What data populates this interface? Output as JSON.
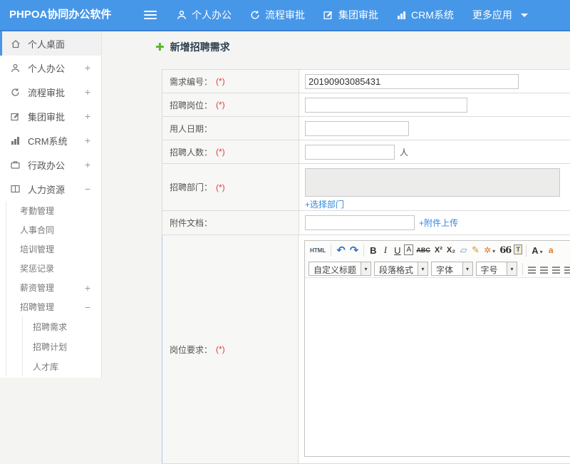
{
  "colors": {
    "header_bg": "#4797e8",
    "header_border": "#3b7fd4",
    "active_item_accent": "#4797e8",
    "link_blue": "#3388dd",
    "required_red": "#e43c3c",
    "title_text": "#2f4050",
    "add_icon_green": "#55b82a"
  },
  "header": {
    "logo": "PHPOA协同办公软件",
    "nav_items": [
      {
        "label": "个人办公",
        "icon": "person-icon"
      },
      {
        "label": "流程审批",
        "icon": "workflow-icon"
      },
      {
        "label": "集团审批",
        "icon": "edit-icon"
      },
      {
        "label": "CRM系统",
        "icon": "bar-chart-icon"
      },
      {
        "label": "更多应用",
        "icon": "caret-down-icon"
      }
    ]
  },
  "sidebar": {
    "items": [
      {
        "label": "个人桌面",
        "icon": "home-icon",
        "active": true,
        "expand": ""
      },
      {
        "label": "个人办公",
        "icon": "person-icon",
        "expand": "+"
      },
      {
        "label": "流程审批",
        "icon": "workflow-icon",
        "expand": "+"
      },
      {
        "label": "集团审批",
        "icon": "edit-icon",
        "expand": "+"
      },
      {
        "label": "CRM系统",
        "icon": "bar-chart-icon",
        "expand": "+"
      },
      {
        "label": "行政办公",
        "icon": "briefcase-icon",
        "expand": "+"
      },
      {
        "label": "人力资源",
        "icon": "book-icon",
        "expand": "−"
      }
    ],
    "hr_children": [
      {
        "label": "考勤管理",
        "expand": ""
      },
      {
        "label": "人事合同",
        "expand": ""
      },
      {
        "label": "培训管理",
        "expand": ""
      },
      {
        "label": "奖惩记录",
        "expand": ""
      },
      {
        "label": "薪资管理",
        "expand": "+"
      },
      {
        "label": "招聘管理",
        "expand": "−"
      }
    ],
    "recruit_children": [
      {
        "label": "招聘需求"
      },
      {
        "label": "招聘计划"
      },
      {
        "label": "人才库"
      }
    ]
  },
  "main": {
    "title": "新增招聘需求",
    "form": {
      "rows": {
        "demand_no": {
          "label": "需求编号：",
          "required": "(*)",
          "value": "20190903085431"
        },
        "position": {
          "label": "招聘岗位：",
          "required": "(*)",
          "value": ""
        },
        "hire_date": {
          "label": "用人日期：",
          "value": ""
        },
        "headcount": {
          "label": "招聘人数：",
          "required": "(*)",
          "value": "",
          "unit": "人"
        },
        "department": {
          "label": "招聘部门：",
          "required": "(*)",
          "link": "+选择部门"
        },
        "attachment": {
          "label": "附件文档：",
          "value": "",
          "link": "+附件上传"
        },
        "requirements": {
          "label": "岗位要求：",
          "required": "(*)"
        }
      }
    },
    "editor": {
      "buttons": {
        "source": "HTML",
        "undo": "↶",
        "redo": "↷",
        "bold": "B",
        "italic": "I",
        "underline": "U",
        "font_box": "A",
        "strikethrough": "ABC",
        "superscript": "X²",
        "subscript": "X₂",
        "remove_format": "▱",
        "quick_format": "✎",
        "format_painter": "✲",
        "blockquote": "66",
        "paste_text": "T",
        "font_color": "A",
        "highlight": "a"
      },
      "selects": {
        "heading": "自定义标题",
        "paragraph": "段落格式",
        "font_family": "字体",
        "font_size": "字号"
      }
    }
  }
}
